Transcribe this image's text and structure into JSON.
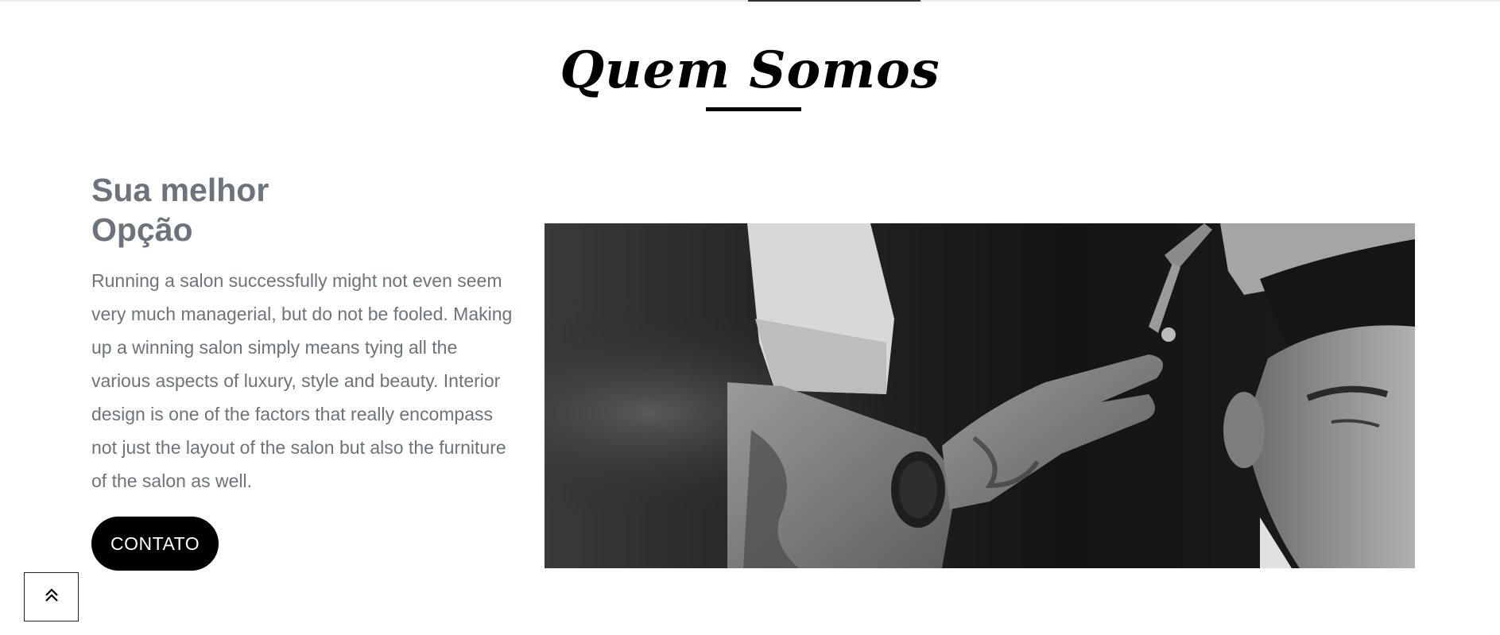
{
  "about": {
    "title": "Quem Somos",
    "subtitle_line1": "Sua melhor",
    "subtitle_line2": "Opção",
    "description": "Running a salon successfully might not even seem very much managerial, but do not be fooled. Making up a winning salon simply means tying all the various aspects of luxury, style and beauty. Interior design is one of the factors that really encompass not just the layout of the salon but also the furniture of the salon as well.",
    "cta_label": "CONTATO",
    "image_icon": "barber-cutting-hair-photo"
  },
  "scroll_top": {
    "icon": "double-chevron-up-icon"
  },
  "colors": {
    "title": "#000000",
    "body_text": "#6c737a",
    "button_bg": "#000000",
    "button_text": "#ffffff"
  }
}
